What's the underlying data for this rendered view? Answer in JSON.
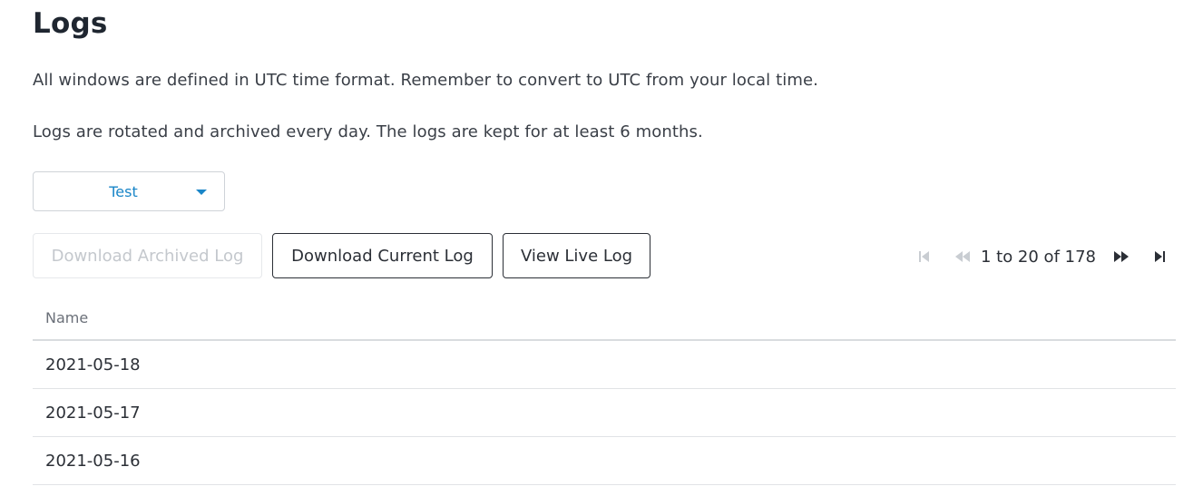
{
  "page": {
    "title": "Logs",
    "info_lines": [
      "All windows are defined in UTC time format. Remember to convert to UTC from your local time.",
      "Logs are rotated and archived every day. The logs are kept for at least 6 months."
    ]
  },
  "environment_select": {
    "selected": "Test",
    "accent_color": "#1a86c8"
  },
  "actions": {
    "download_archived": {
      "label": "Download Archived Log",
      "disabled": true
    },
    "download_current": {
      "label": "Download Current Log",
      "disabled": false
    },
    "view_live": {
      "label": "View Live Log",
      "disabled": false
    }
  },
  "pagination": {
    "summary": "1 to 20 of 178",
    "icons": [
      "first-page-icon",
      "previous-page-icon",
      "next-page-icon",
      "last-page-icon"
    ]
  },
  "table": {
    "columns": [
      "Name"
    ],
    "rows": [
      {
        "name": "2021-05-18"
      },
      {
        "name": "2021-05-17"
      },
      {
        "name": "2021-05-16"
      }
    ]
  }
}
